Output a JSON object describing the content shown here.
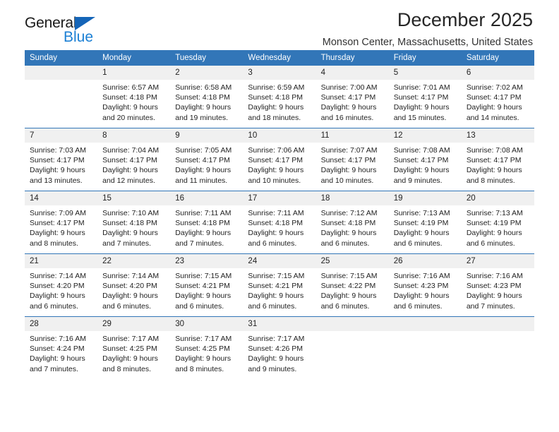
{
  "brand": {
    "name_part1": "General",
    "name_part2": "Blue",
    "accent_color": "#1a7fd4",
    "triangle_color": "#1565b8"
  },
  "header": {
    "title": "December 2025",
    "subtitle": "Monson Center, Massachusetts, United States"
  },
  "calendar": {
    "header_color": "#3276b8",
    "weekday_headers": [
      "Sunday",
      "Monday",
      "Tuesday",
      "Wednesday",
      "Thursday",
      "Friday",
      "Saturday"
    ],
    "weeks": [
      [
        {
          "day": "",
          "sunrise": "",
          "sunset": "",
          "daylight_line1": "",
          "daylight_line2": ""
        },
        {
          "day": "1",
          "sunrise": "Sunrise: 6:57 AM",
          "sunset": "Sunset: 4:18 PM",
          "daylight_line1": "Daylight: 9 hours",
          "daylight_line2": "and 20 minutes."
        },
        {
          "day": "2",
          "sunrise": "Sunrise: 6:58 AM",
          "sunset": "Sunset: 4:18 PM",
          "daylight_line1": "Daylight: 9 hours",
          "daylight_line2": "and 19 minutes."
        },
        {
          "day": "3",
          "sunrise": "Sunrise: 6:59 AM",
          "sunset": "Sunset: 4:18 PM",
          "daylight_line1": "Daylight: 9 hours",
          "daylight_line2": "and 18 minutes."
        },
        {
          "day": "4",
          "sunrise": "Sunrise: 7:00 AM",
          "sunset": "Sunset: 4:17 PM",
          "daylight_line1": "Daylight: 9 hours",
          "daylight_line2": "and 16 minutes."
        },
        {
          "day": "5",
          "sunrise": "Sunrise: 7:01 AM",
          "sunset": "Sunset: 4:17 PM",
          "daylight_line1": "Daylight: 9 hours",
          "daylight_line2": "and 15 minutes."
        },
        {
          "day": "6",
          "sunrise": "Sunrise: 7:02 AM",
          "sunset": "Sunset: 4:17 PM",
          "daylight_line1": "Daylight: 9 hours",
          "daylight_line2": "and 14 minutes."
        }
      ],
      [
        {
          "day": "7",
          "sunrise": "Sunrise: 7:03 AM",
          "sunset": "Sunset: 4:17 PM",
          "daylight_line1": "Daylight: 9 hours",
          "daylight_line2": "and 13 minutes."
        },
        {
          "day": "8",
          "sunrise": "Sunrise: 7:04 AM",
          "sunset": "Sunset: 4:17 PM",
          "daylight_line1": "Daylight: 9 hours",
          "daylight_line2": "and 12 minutes."
        },
        {
          "day": "9",
          "sunrise": "Sunrise: 7:05 AM",
          "sunset": "Sunset: 4:17 PM",
          "daylight_line1": "Daylight: 9 hours",
          "daylight_line2": "and 11 minutes."
        },
        {
          "day": "10",
          "sunrise": "Sunrise: 7:06 AM",
          "sunset": "Sunset: 4:17 PM",
          "daylight_line1": "Daylight: 9 hours",
          "daylight_line2": "and 10 minutes."
        },
        {
          "day": "11",
          "sunrise": "Sunrise: 7:07 AM",
          "sunset": "Sunset: 4:17 PM",
          "daylight_line1": "Daylight: 9 hours",
          "daylight_line2": "and 10 minutes."
        },
        {
          "day": "12",
          "sunrise": "Sunrise: 7:08 AM",
          "sunset": "Sunset: 4:17 PM",
          "daylight_line1": "Daylight: 9 hours",
          "daylight_line2": "and 9 minutes."
        },
        {
          "day": "13",
          "sunrise": "Sunrise: 7:08 AM",
          "sunset": "Sunset: 4:17 PM",
          "daylight_line1": "Daylight: 9 hours",
          "daylight_line2": "and 8 minutes."
        }
      ],
      [
        {
          "day": "14",
          "sunrise": "Sunrise: 7:09 AM",
          "sunset": "Sunset: 4:17 PM",
          "daylight_line1": "Daylight: 9 hours",
          "daylight_line2": "and 8 minutes."
        },
        {
          "day": "15",
          "sunrise": "Sunrise: 7:10 AM",
          "sunset": "Sunset: 4:18 PM",
          "daylight_line1": "Daylight: 9 hours",
          "daylight_line2": "and 7 minutes."
        },
        {
          "day": "16",
          "sunrise": "Sunrise: 7:11 AM",
          "sunset": "Sunset: 4:18 PM",
          "daylight_line1": "Daylight: 9 hours",
          "daylight_line2": "and 7 minutes."
        },
        {
          "day": "17",
          "sunrise": "Sunrise: 7:11 AM",
          "sunset": "Sunset: 4:18 PM",
          "daylight_line1": "Daylight: 9 hours",
          "daylight_line2": "and 6 minutes."
        },
        {
          "day": "18",
          "sunrise": "Sunrise: 7:12 AM",
          "sunset": "Sunset: 4:18 PM",
          "daylight_line1": "Daylight: 9 hours",
          "daylight_line2": "and 6 minutes."
        },
        {
          "day": "19",
          "sunrise": "Sunrise: 7:13 AM",
          "sunset": "Sunset: 4:19 PM",
          "daylight_line1": "Daylight: 9 hours",
          "daylight_line2": "and 6 minutes."
        },
        {
          "day": "20",
          "sunrise": "Sunrise: 7:13 AM",
          "sunset": "Sunset: 4:19 PM",
          "daylight_line1": "Daylight: 9 hours",
          "daylight_line2": "and 6 minutes."
        }
      ],
      [
        {
          "day": "21",
          "sunrise": "Sunrise: 7:14 AM",
          "sunset": "Sunset: 4:20 PM",
          "daylight_line1": "Daylight: 9 hours",
          "daylight_line2": "and 6 minutes."
        },
        {
          "day": "22",
          "sunrise": "Sunrise: 7:14 AM",
          "sunset": "Sunset: 4:20 PM",
          "daylight_line1": "Daylight: 9 hours",
          "daylight_line2": "and 6 minutes."
        },
        {
          "day": "23",
          "sunrise": "Sunrise: 7:15 AM",
          "sunset": "Sunset: 4:21 PM",
          "daylight_line1": "Daylight: 9 hours",
          "daylight_line2": "and 6 minutes."
        },
        {
          "day": "24",
          "sunrise": "Sunrise: 7:15 AM",
          "sunset": "Sunset: 4:21 PM",
          "daylight_line1": "Daylight: 9 hours",
          "daylight_line2": "and 6 minutes."
        },
        {
          "day": "25",
          "sunrise": "Sunrise: 7:15 AM",
          "sunset": "Sunset: 4:22 PM",
          "daylight_line1": "Daylight: 9 hours",
          "daylight_line2": "and 6 minutes."
        },
        {
          "day": "26",
          "sunrise": "Sunrise: 7:16 AM",
          "sunset": "Sunset: 4:23 PM",
          "daylight_line1": "Daylight: 9 hours",
          "daylight_line2": "and 6 minutes."
        },
        {
          "day": "27",
          "sunrise": "Sunrise: 7:16 AM",
          "sunset": "Sunset: 4:23 PM",
          "daylight_line1": "Daylight: 9 hours",
          "daylight_line2": "and 7 minutes."
        }
      ],
      [
        {
          "day": "28",
          "sunrise": "Sunrise: 7:16 AM",
          "sunset": "Sunset: 4:24 PM",
          "daylight_line1": "Daylight: 9 hours",
          "daylight_line2": "and 7 minutes."
        },
        {
          "day": "29",
          "sunrise": "Sunrise: 7:17 AM",
          "sunset": "Sunset: 4:25 PM",
          "daylight_line1": "Daylight: 9 hours",
          "daylight_line2": "and 8 minutes."
        },
        {
          "day": "30",
          "sunrise": "Sunrise: 7:17 AM",
          "sunset": "Sunset: 4:25 PM",
          "daylight_line1": "Daylight: 9 hours",
          "daylight_line2": "and 8 minutes."
        },
        {
          "day": "31",
          "sunrise": "Sunrise: 7:17 AM",
          "sunset": "Sunset: 4:26 PM",
          "daylight_line1": "Daylight: 9 hours",
          "daylight_line2": "and 9 minutes."
        },
        {
          "day": "",
          "sunrise": "",
          "sunset": "",
          "daylight_line1": "",
          "daylight_line2": ""
        },
        {
          "day": "",
          "sunrise": "",
          "sunset": "",
          "daylight_line1": "",
          "daylight_line2": ""
        },
        {
          "day": "",
          "sunrise": "",
          "sunset": "",
          "daylight_line1": "",
          "daylight_line2": ""
        }
      ]
    ]
  }
}
